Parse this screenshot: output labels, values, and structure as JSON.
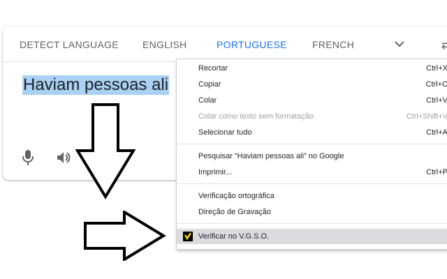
{
  "tabs": {
    "detect": "DETECT LANGUAGE",
    "english": "ENGLISH",
    "portuguese": "PORTUGUESE",
    "french": "FRENCH"
  },
  "source": {
    "text": "Haviam pessoas ali"
  },
  "icons": {
    "tabs_more": "chevron-down-icon",
    "swap": "swap-arrows-icon",
    "mic": "microphone-icon",
    "speaker": "speaker-icon",
    "arrow_down": "hollow-arrow-down-icon",
    "arrow_right": "hollow-arrow-right-icon",
    "extension": "vgso-extension-icon"
  },
  "colors": {
    "accent": "#1a73e8",
    "selection": "#a8d1f3",
    "menu_highlight": "#dadce0"
  },
  "swap_glyph": "⇄",
  "context_menu": {
    "cut": {
      "label": "Recortar",
      "shortcut": "Ctrl+X"
    },
    "copy": {
      "label": "Copiar",
      "shortcut": "Ctrl+C"
    },
    "paste": {
      "label": "Colar",
      "shortcut": "Ctrl+V"
    },
    "paste_plain": {
      "label": "Colar como texto sem formatação",
      "shortcut": "Ctrl+Shift+V"
    },
    "select_all": {
      "label": "Selecionar tudo",
      "shortcut": "Ctrl+A"
    },
    "search": {
      "label": "Pesquisar “Haviam pessoas ali” no Google"
    },
    "print": {
      "label": "Imprimir...",
      "shortcut": "Ctrl+P"
    },
    "spellcheck": {
      "label": "Verificação ortográfica"
    },
    "writing_direction": {
      "label": "Direção de Gravação"
    },
    "vgso": {
      "label": "Verificar no V.G.S.O."
    }
  }
}
